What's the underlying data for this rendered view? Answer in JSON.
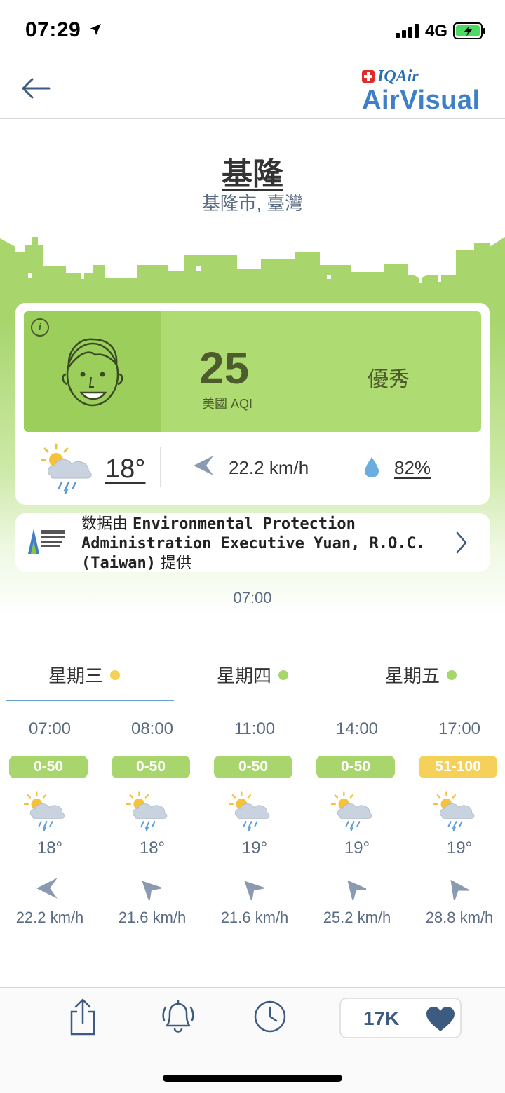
{
  "status_bar": {
    "time": "07:29",
    "network": "4G"
  },
  "header": {
    "logo_top": "IQAir",
    "logo_bottom": "AirVisual"
  },
  "location": {
    "city": "基隆",
    "region": "基隆市, 臺灣"
  },
  "aqi": {
    "value": "25",
    "label": "美國 AQI",
    "status": "優秀",
    "panel_color": "#afdc72",
    "face_panel_color": "#9bce5a"
  },
  "weather_now": {
    "temperature": "18°",
    "wind": "22.2 km/h",
    "humidity": "82%",
    "icon": "partly-cloudy-rain-icon"
  },
  "source": {
    "prefix": "数据由 ",
    "name": "Environmental Protection Administration Executive Yuan, R.O.C. (Taiwan)",
    "suffix": " 提供"
  },
  "update_time": "07:00",
  "day_tabs": [
    {
      "label": "星期三",
      "dot_color": "#f5d15a"
    },
    {
      "label": "星期四",
      "dot_color": "#a8d66d"
    },
    {
      "label": "星期五",
      "dot_color": "#a8d66d"
    }
  ],
  "hourly": [
    {
      "time": "07:00",
      "aqi_range": "0-50",
      "badge_color": "#a8d66d",
      "temp": "18°",
      "wind": "22.2 km/h",
      "wind_dir": "west"
    },
    {
      "time": "08:00",
      "aqi_range": "0-50",
      "badge_color": "#a8d66d",
      "temp": "18°",
      "wind": "21.6 km/h",
      "wind_dir": "north-west"
    },
    {
      "time": "11:00",
      "aqi_range": "0-50",
      "badge_color": "#a8d66d",
      "temp": "19°",
      "wind": "21.6 km/h",
      "wind_dir": "north-west"
    },
    {
      "time": "14:00",
      "aqi_range": "0-50",
      "badge_color": "#a8d66d",
      "temp": "19°",
      "wind": "25.2 km/h",
      "wind_dir": "north-west"
    },
    {
      "time": "17:00",
      "aqi_range": "51-100",
      "badge_color": "#f5d15a",
      "temp": "19°",
      "wind": "28.8 km/h",
      "wind_dir": "north-west"
    }
  ],
  "tab_bar": {
    "followers": "17K"
  }
}
